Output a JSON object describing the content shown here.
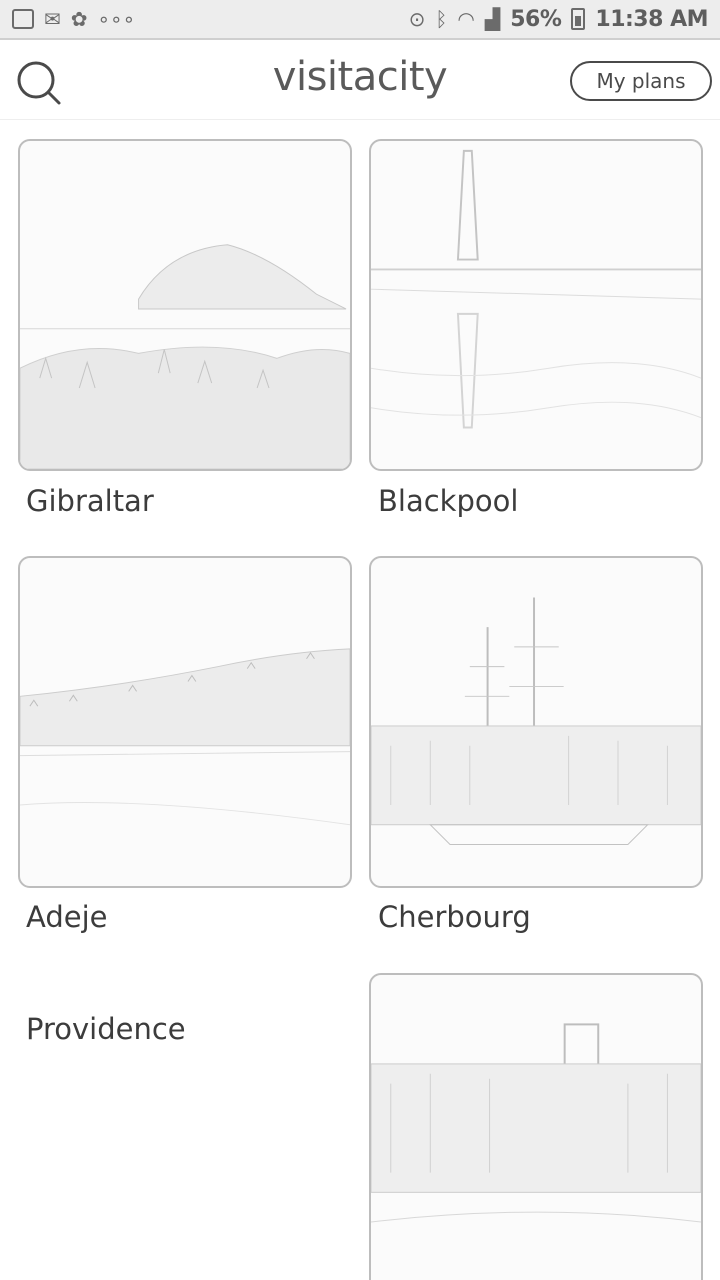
{
  "status_bar": {
    "battery": "56%",
    "time": "11:38 AM"
  },
  "header": {
    "logo": "visitacity",
    "my_plans": "My plans"
  },
  "cities": [
    {
      "name": "Gibraltar"
    },
    {
      "name": "Blackpool"
    },
    {
      "name": "Adeje"
    },
    {
      "name": "Cherbourg"
    },
    {
      "name": "Providence"
    }
  ]
}
